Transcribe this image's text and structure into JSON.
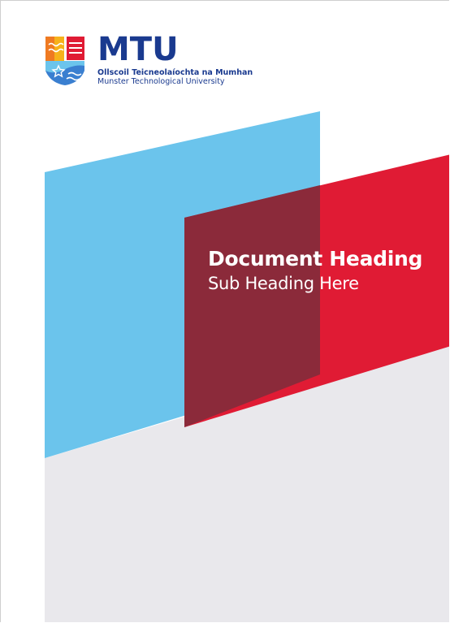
{
  "logo": {
    "wordmark": "MTU",
    "irish_name": "Ollscoil Teicneolaíochta na Mumhan",
    "english_name": "Munster Technological University"
  },
  "cover": {
    "heading": "Document Heading",
    "subheading": "Sub Heading Here"
  },
  "colors": {
    "brand_blue": "#1a3a8f",
    "sky_blue": "#6bc4ec",
    "red": "#e01b34",
    "maroon": "#8b2a3a",
    "grey": "#e9e8ec",
    "logo_yellow": "#f6b21b",
    "logo_orange": "#ef7a22",
    "logo_red": "#e01b34"
  }
}
